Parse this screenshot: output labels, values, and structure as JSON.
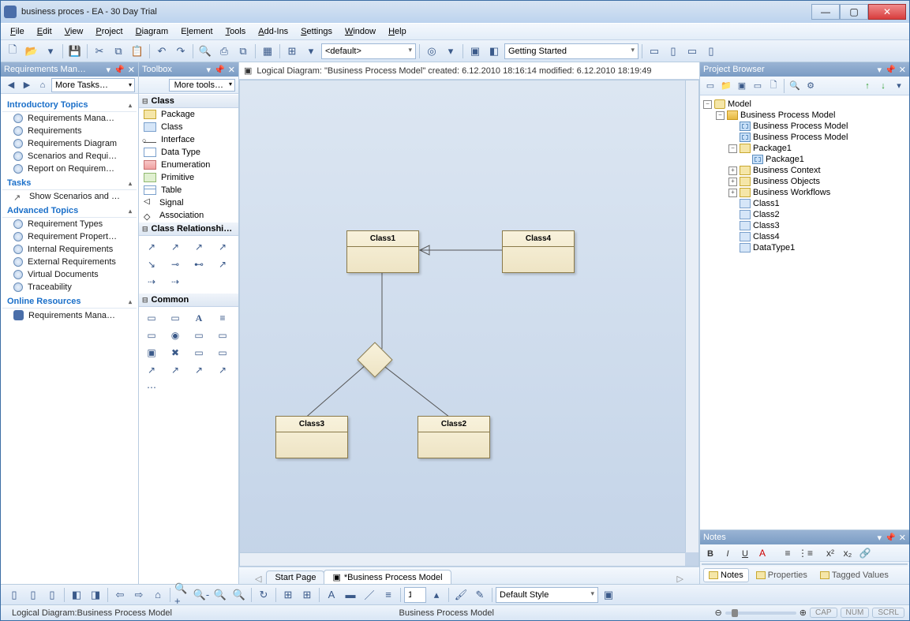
{
  "window": {
    "title": "business proces - EA - 30 Day Trial"
  },
  "menu": [
    "File",
    "Edit",
    "View",
    "Project",
    "Diagram",
    "Element",
    "Tools",
    "Add-Ins",
    "Settings",
    "Window",
    "Help"
  ],
  "toolbar1": {
    "default_combo": "<default>",
    "getting_started": "Getting Started"
  },
  "panels": {
    "requirements": {
      "title": "Requirements Man…",
      "more_tasks": "More Tasks…",
      "sections": {
        "intro": {
          "header": "Introductory Topics",
          "items": [
            "Requirements Mana…",
            "Requirements",
            "Requirements Diagram",
            "Scenarios and Requi…",
            "Report on Requirem…"
          ]
        },
        "tasks": {
          "header": "Tasks",
          "items": [
            "Show Scenarios and …"
          ]
        },
        "advanced": {
          "header": "Advanced Topics",
          "items": [
            "Requirement Types",
            "Requirement Propert…",
            "Internal Requirements",
            "External Requirements",
            "Virtual Documents",
            "Traceability"
          ]
        },
        "online": {
          "header": "Online Resources",
          "items": [
            "Requirements Mana…"
          ]
        }
      }
    },
    "toolbox": {
      "title": "Toolbox",
      "more": "More tools…",
      "class_hdr": "Class",
      "class_items": [
        "Package",
        "Class",
        "Interface",
        "Data Type",
        "Enumeration",
        "Primitive",
        "Table",
        "Signal",
        "Association"
      ],
      "rel_hdr": "Class Relationshi…",
      "common_hdr": "Common"
    },
    "project_browser": {
      "title": "Project Browser",
      "tree": {
        "model": "Model",
        "bpm": "Business Process Model",
        "bpm_diag1": "Business Process Model",
        "bpm_diag2": "Business Process Model",
        "pkg1": "Package1",
        "pkg1_child": "Package1",
        "bcontext": "Business Context",
        "bobjects": "Business Objects",
        "bworkflows": "Business Workflows",
        "cls1": "Class1",
        "cls2": "Class2",
        "cls3": "Class3",
        "cls4": "Class4",
        "dt1": "DataType1"
      }
    },
    "notes": {
      "title": "Notes",
      "tabs": {
        "notes": "Notes",
        "props": "Properties",
        "tagged": "Tagged Values"
      }
    }
  },
  "canvas": {
    "header": "Logical Diagram: \"Business Process Model\"   created: 6.12.2010 18:16:14  modified: 6.12.2010 18:19:49",
    "classes": {
      "c1": "Class1",
      "c2": "Class2",
      "c3": "Class3",
      "c4": "Class4"
    },
    "tabs": {
      "start": "Start Page",
      "bpm": "*Business Process Model"
    }
  },
  "bottom_tb": {
    "style": "Default Style",
    "spin": "1"
  },
  "status": {
    "left": "Logical Diagram:Business Process Model",
    "mid": "Business Process Model",
    "cap": "CAP",
    "num": "NUM",
    "scrl": "SCRL"
  }
}
